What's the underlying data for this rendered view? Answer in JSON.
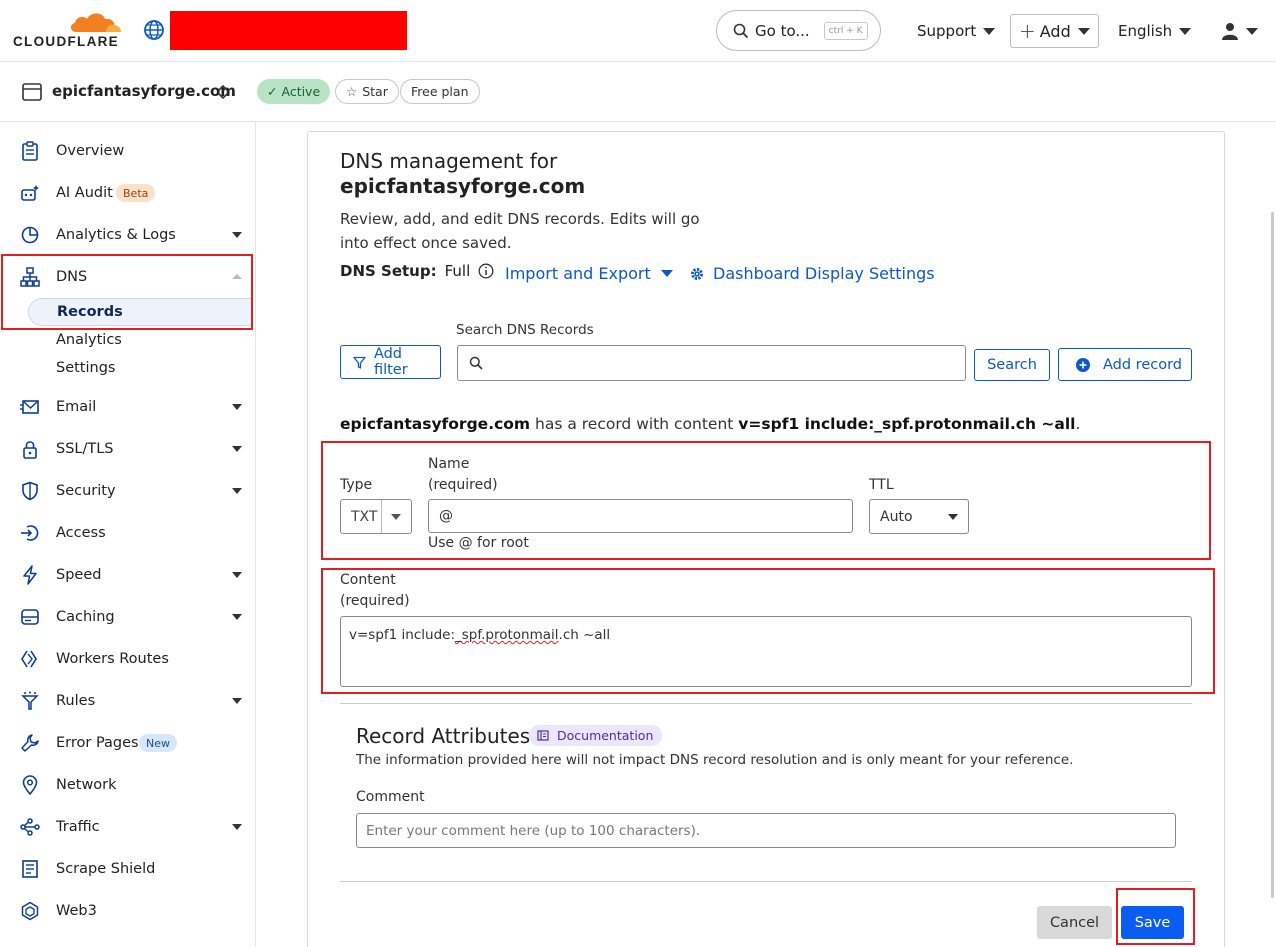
{
  "topbar": {
    "brand": "CLOUDFLARE",
    "goto_label": "Go to...",
    "goto_shortcut": "ctrl + K",
    "support_label": "Support",
    "add_label": "Add",
    "language_label": "English"
  },
  "zone": {
    "name": "epicfantasyforge.com",
    "status": "Active",
    "star_label": "Star",
    "plan_label": "Free plan"
  },
  "sidebar": {
    "items": [
      {
        "label": "Overview",
        "icon": "clipboard-icon"
      },
      {
        "label": "AI Audit",
        "icon": "robot-icon",
        "badge": "Beta"
      },
      {
        "label": "Analytics & Logs",
        "icon": "pie-chart-icon"
      },
      {
        "label": "DNS",
        "icon": "network-tree-icon"
      },
      {
        "label": "Email",
        "icon": "envelope-icon"
      },
      {
        "label": "SSL/TLS",
        "icon": "lock-icon"
      },
      {
        "label": "Security",
        "icon": "shield-icon"
      },
      {
        "label": "Access",
        "icon": "access-icon"
      },
      {
        "label": "Speed",
        "icon": "lightning-icon"
      },
      {
        "label": "Caching",
        "icon": "storage-icon"
      },
      {
        "label": "Workers Routes",
        "icon": "workers-icon"
      },
      {
        "label": "Rules",
        "icon": "funnel-rules-icon"
      },
      {
        "label": "Error Pages",
        "icon": "wrench-icon",
        "badge": "New"
      },
      {
        "label": "Network",
        "icon": "location-pin-icon"
      },
      {
        "label": "Traffic",
        "icon": "traffic-icon"
      },
      {
        "label": "Scrape Shield",
        "icon": "document-icon"
      },
      {
        "label": "Web3",
        "icon": "web3-icon"
      }
    ],
    "dns_subitems": [
      "Records",
      "Analytics",
      "Settings"
    ]
  },
  "main": {
    "heading_prefix": "DNS management for",
    "heading_zone": "epicfantasyforge.com",
    "description": "Review, add, and edit DNS records. Edits will go into effect once saved.",
    "dns_setup_label": "DNS Setup:",
    "dns_setup_value": "Full",
    "import_export_label": "Import and Export",
    "dashboard_settings_label": "Dashboard Display Settings",
    "search_label": "Search DNS Records",
    "search_placeholder": "",
    "add_filter_label": "Add filter",
    "search_button": "Search",
    "add_record_button": "Add record",
    "message": {
      "zone": "epicfantasyforge.com",
      "middle": " has a record with content ",
      "content": "v=spf1 include:_spf.protonmail.ch ~all",
      "end": "."
    },
    "form": {
      "type_label": "Type",
      "type_value": "TXT",
      "name_label_1": "Name",
      "name_label_2": "(required)",
      "name_value": "@",
      "name_hint": "Use @ for root",
      "ttl_label": "TTL",
      "ttl_value": "Auto",
      "content_label_1": "Content",
      "content_label_2": "(required)",
      "content_value_a": "v=spf1 include:",
      "content_value_b": "_spf.protonmail",
      "content_value_c": ".ch ~all"
    },
    "attributes": {
      "title": "Record Attributes",
      "doc_label": "Documentation",
      "description": "The information provided here will not impact DNS record resolution and is only meant for your reference.",
      "comment_label": "Comment",
      "comment_placeholder": "Enter your comment here (up to 100 characters)."
    },
    "cancel_label": "Cancel",
    "save_label": "Save"
  },
  "colors": {
    "accent": "#0b59c8",
    "save": "#0b5cf0",
    "highlight": "#e02020",
    "active_pill": "#b9e3c5",
    "cloudflare_orange": "#f38020"
  }
}
